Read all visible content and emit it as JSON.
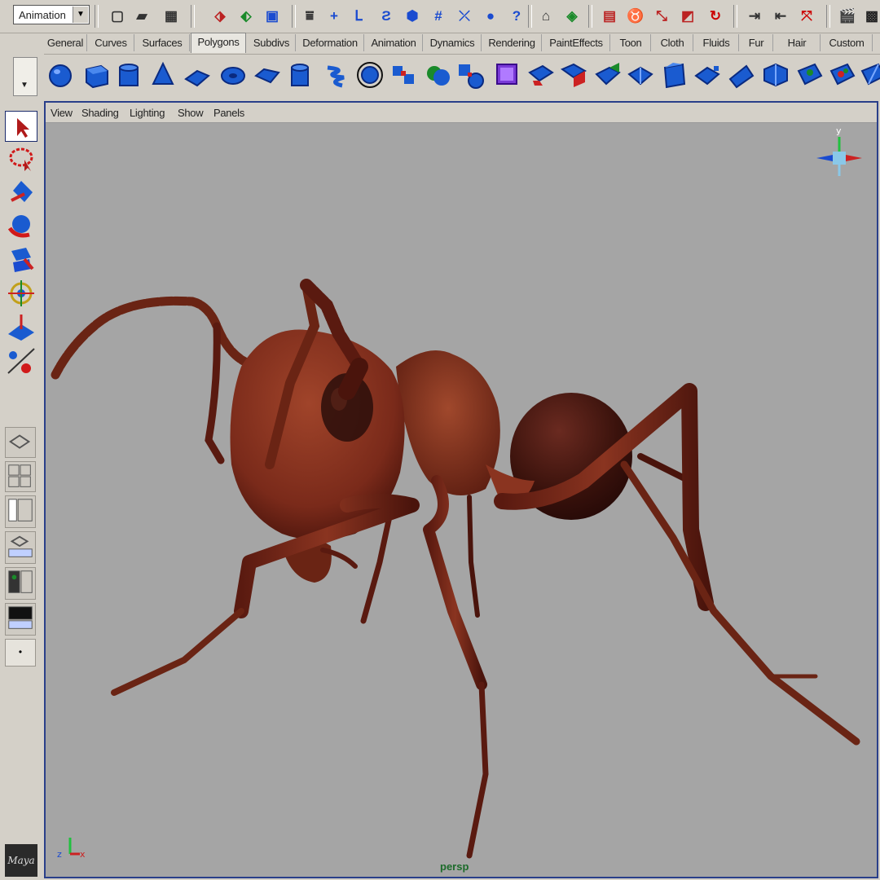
{
  "app": {
    "name": "Maya"
  },
  "menu_set": {
    "selected": "Animation"
  },
  "shelf_tabs": [
    "General",
    "Curves",
    "Surfaces",
    "Polygons",
    "Subdivs",
    "Deformation",
    "Animation",
    "Dynamics",
    "Rendering",
    "PaintEffects",
    "Toon",
    "Cloth",
    "Fluids",
    "Fur",
    "Hair",
    "Custom"
  ],
  "active_shelf_tab": "Polygons",
  "viewport": {
    "menus": [
      "View",
      "Shading",
      "Lighting",
      "Show",
      "Panels"
    ],
    "camera_label": "persp",
    "view_cube_label": "y",
    "axis_labels": {
      "z": "z",
      "x": "x",
      "y": "y"
    },
    "background_color": "#a5a5a5"
  },
  "scene": {
    "object": "ant-model",
    "body_color": "#7a2a1a"
  },
  "status_icons": [
    "select-by-hierarchy",
    "select-by-component",
    "snap-grid",
    "snap-curve",
    "snap-point",
    "help",
    "render",
    "ipr-render",
    "history",
    "input-output",
    "magnet"
  ]
}
